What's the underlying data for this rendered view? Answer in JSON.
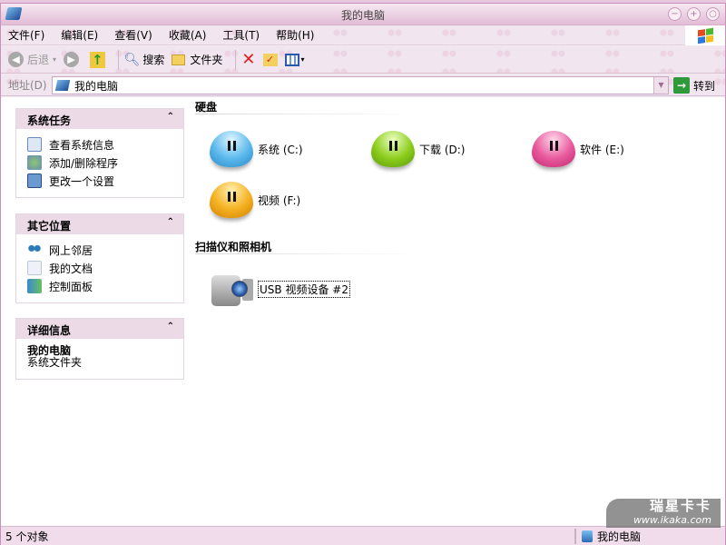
{
  "window": {
    "title": "我的电脑"
  },
  "menu": [
    "文件(F)",
    "编辑(E)",
    "查看(V)",
    "收藏(A)",
    "工具(T)",
    "帮助(H)"
  ],
  "toolbar": {
    "back": "后退",
    "search": "搜索",
    "folders": "文件夹"
  },
  "address": {
    "label": "地址(D)",
    "value": "我的电脑",
    "go": "转到"
  },
  "panels": {
    "tasks": {
      "title": "系统任务",
      "items": [
        "查看系统信息",
        "添加/删除程序",
        "更改一个设置"
      ]
    },
    "places": {
      "title": "其它位置",
      "items": [
        "网上邻居",
        "我的文档",
        "控制面板"
      ]
    },
    "details": {
      "title": "详细信息",
      "name": "我的电脑",
      "type": "系统文件夹"
    }
  },
  "sections": {
    "drives": {
      "title": "硬盘",
      "items": [
        {
          "label": "系统 (C:)",
          "color": "#5ab8ec"
        },
        {
          "label": "下载 (D:)",
          "color": "#8ccc1c"
        },
        {
          "label": "软件 (E:)",
          "color": "#e8589c"
        },
        {
          "label": "视频 (F:)",
          "color": "#f4b020"
        }
      ]
    },
    "scanners": {
      "title": "扫描仪和照相机",
      "items": [
        {
          "label": "USB 视频设备 #2"
        }
      ]
    }
  },
  "status": {
    "count": "5 个对象",
    "location": "我的电脑"
  },
  "watermark": {
    "brand": "瑞星卡卡",
    "url": "www.ikaka.com"
  }
}
